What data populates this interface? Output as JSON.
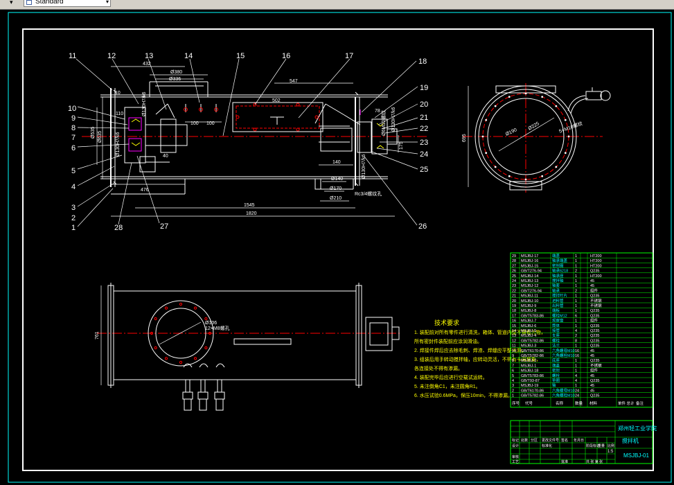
{
  "toolbar": {
    "dropdown_arrow": "▾",
    "text_style": "Standard",
    "combo_arrow": "▾"
  },
  "balloons": {
    "left": [
      "10",
      "9",
      "8",
      "7",
      "6",
      "5",
      "4",
      "3",
      "2",
      "1"
    ],
    "top": [
      "11",
      "12",
      "13",
      "14",
      "15",
      "16",
      "17",
      "18"
    ],
    "right": [
      "19",
      "20",
      "21",
      "22",
      "23",
      "24",
      "25"
    ],
    "bottom": [
      "28",
      "27",
      "26"
    ]
  },
  "dims": {
    "d432": "432",
    "d380": "Ø380",
    "d336": "Ø336",
    "d10": "10",
    "d110": "110",
    "d100a": "100",
    "d100b": "100",
    "d547": "547",
    "d502": "502",
    "d78": "78",
    "d140": "140",
    "d140b": "Ø140",
    "d170": "Ø170",
    "d210": "Ø210",
    "d40": "40",
    "d476": "476",
    "d1545": "1545",
    "d1820": "1820",
    "d535": "Ø535",
    "d635": "Ø635",
    "d175": "175",
    "note_left1": "Ø130H7/k6",
    "note_left2": "Ø130H7/k6",
    "note_right1": "Ø130H7/k6",
    "note_right2": "Ø130H7/k6",
    "note_g": "Rc3/4螺纹孔",
    "note_m": "Ø6M10螺纹",
    "c190": "Ø190",
    "c225": "Ø225",
    "c5m10": "5×M10螺纹",
    "c695": "695",
    "f106": "Ø106",
    "f12m": "12×M8螺孔",
    "f761": "761"
  },
  "notes": {
    "title": "技术要求",
    "lines": [
      "1. 装配前对所有零件进行清洗，箱体、管道内壁不得有污物，",
      "所有密封件装配前应涂润滑油。",
      "2. 焊接件焊后应去除毛刺、焊渣、焊缝应平整光滑。",
      "3. 组装后用手转动搅拌轴，应转动灵活，不得有卡滞现象，",
      "各连接处不得有渗漏。",
      "4. 装配完毕后应进行空载试运转。",
      "5. 未注倒角C1，未注圆角R1。",
      "6. 水压试验0.6MPa，保压10min，不得渗漏。"
    ]
  },
  "bom": [
    [
      "29",
      "MSJBJ-17",
      "端盖",
      "1",
      "",
      "HT200"
    ],
    [
      "28",
      "MSJBJ-16",
      "轴承端盖",
      "1",
      "",
      "HT200"
    ],
    [
      "27",
      "MSJBJ-15",
      "密封圈",
      "1",
      "",
      "HT200"
    ],
    [
      "26",
      "GB/T276-94",
      "轴承6218",
      "2",
      "",
      "Q235"
    ],
    [
      "25",
      "MSJBJ-14",
      "轴承座",
      "1",
      "",
      "HT200"
    ],
    [
      "24",
      "MSJBJ-13",
      "搅拌轴",
      "1",
      "",
      "45"
    ],
    [
      "23",
      "MSJBJ-12",
      "轴套",
      "1",
      "",
      "45"
    ],
    [
      "22",
      "GB/T276-94",
      "轴承",
      "2",
      "",
      "组件"
    ],
    [
      "21",
      "MSJBJ-11",
      "搅拌叶片",
      "1",
      "",
      "Q235"
    ],
    [
      "20",
      "MSJBJ-10",
      "进料管",
      "1",
      "",
      "不锈钢"
    ],
    [
      "19",
      "MSJBJ-9",
      "出料管",
      "1",
      "",
      "不锈钢"
    ],
    [
      "18",
      "MSJBJ-8",
      "端板",
      "1",
      "",
      "Q235"
    ],
    [
      "17",
      "GB/T5783-86",
      "螺栓M12",
      "6",
      "",
      "Q235"
    ],
    [
      "16",
      "MSJBJ-7",
      "观察窗",
      "1",
      "",
      "组件"
    ],
    [
      "15",
      "MSJBJ-6",
      "筒体",
      "1",
      "",
      "Q235"
    ],
    [
      "14",
      "MSJBJ-5",
      "接管",
      "4",
      "",
      "Q235"
    ],
    [
      "13",
      "MSJBJ-4",
      "支座",
      "2",
      "",
      "Q235"
    ],
    [
      "12",
      "GB/T5782-86",
      "螺栓",
      "8",
      "",
      "Q235"
    ],
    [
      "11",
      "MSJBJ-3",
      "法兰",
      "1",
      "",
      "Q235"
    ],
    [
      "10",
      "GB/T6170-86",
      "六角螺母M10",
      "16",
      "",
      "45"
    ],
    [
      "9",
      "GB/T5782-86",
      "六角螺栓M10",
      "16",
      "",
      "45"
    ],
    [
      "8",
      "MSJBJ-2",
      "底座",
      "1",
      "",
      "Q235"
    ],
    [
      "7",
      "MSJBJ-1",
      "端盖",
      "1",
      "",
      "不锈钢"
    ],
    [
      "6",
      "MSJBJ-18",
      "密封",
      "1",
      "",
      "组件"
    ],
    [
      "5",
      "GB/T5783-86",
      "螺栓",
      "4",
      "",
      "45"
    ],
    [
      "4",
      "GB/T93-87",
      "垫圈",
      "4",
      "",
      "Q235"
    ],
    [
      "3",
      "MSJBJ-19",
      "轴",
      "1",
      "",
      "45"
    ],
    [
      "2",
      "GB/T6170-86",
      "六角螺母M10",
      "24",
      "",
      "45"
    ],
    [
      "1",
      "GB/T5782-86",
      "六角螺栓M10",
      "24",
      "",
      "Q235"
    ]
  ],
  "bom_header": [
    "序号",
    "代号",
    "名称",
    "数量",
    "材料",
    "单件 总计",
    "备注"
  ],
  "title_block": {
    "school": "郑州轻工业学院",
    "drawing_name": "搅拌机",
    "drawing_no": "MSJBJ-01",
    "scale": "1:5",
    "rows": [
      "标记",
      "处数",
      "分区",
      "更改文件号",
      "签名",
      "年月日"
    ],
    "roles": [
      "设计",
      "审核",
      "工艺",
      "批准",
      "标准化"
    ],
    "stage": "阶段标记",
    "weight": "重量",
    "ratio": "比例",
    "sheet": "共  张 第  张"
  },
  "colors": {
    "line_white": "#ffffff",
    "line_green": "#00ff00",
    "line_cyan": "#00ffff",
    "line_red": "#ff0000",
    "line_yellow": "#ffff00",
    "line_magenta": "#ff00ff",
    "bg": "#000000"
  }
}
